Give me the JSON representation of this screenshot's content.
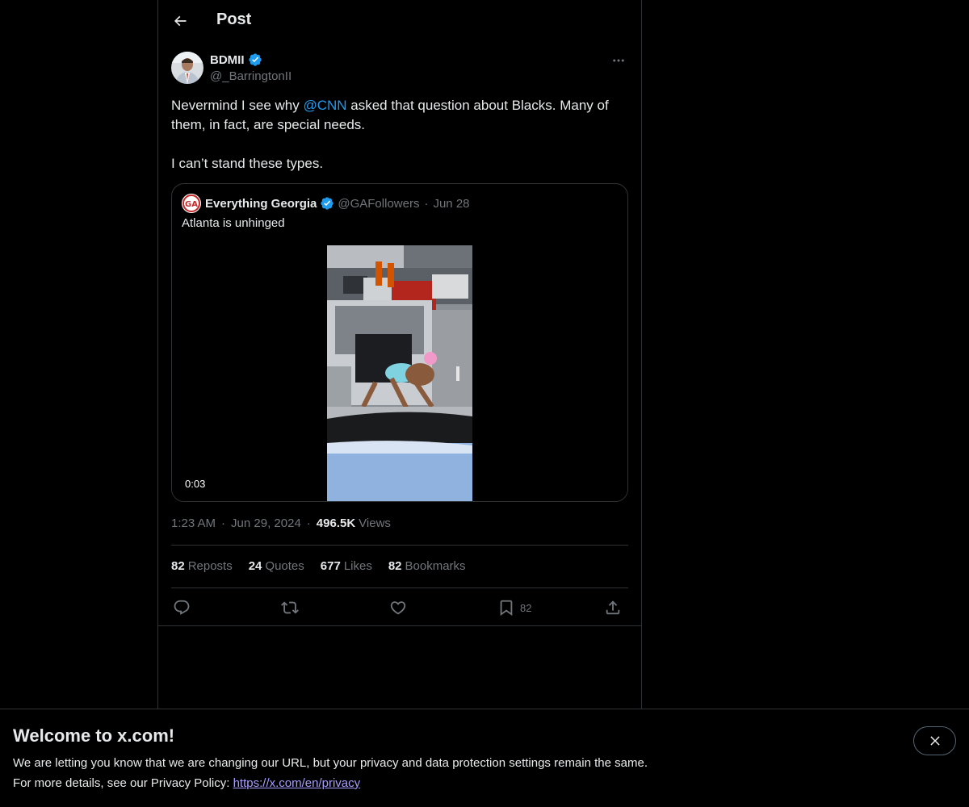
{
  "header": {
    "title": "Post"
  },
  "author": {
    "name": "BDMII",
    "handle": "@_BarringtonII",
    "verified": true
  },
  "tweet": {
    "text_before_mention": "Nevermind I see why ",
    "mention": "@CNN",
    "text_after_mention": " asked that question about Blacks. Many of them, in fact, are special needs.",
    "text_second_paragraph": "I can’t stand these types."
  },
  "quoted": {
    "name": "Everything Georgia",
    "handle": "@GAFollowers",
    "separator": "·",
    "date": "Jun 28",
    "text": "Atlanta is unhinged",
    "video_duration": "0:03",
    "avatar_text": "GA"
  },
  "meta": {
    "time": "1:23 AM",
    "separator": "·",
    "date": "Jun 29, 2024",
    "views_count": "496.5K",
    "views_label": "Views"
  },
  "stats": [
    {
      "count": "82",
      "label": "Reposts"
    },
    {
      "count": "24",
      "label": "Quotes"
    },
    {
      "count": "677",
      "label": "Likes"
    },
    {
      "count": "82",
      "label": "Bookmarks"
    }
  ],
  "actions": {
    "reply_icon": "reply-icon",
    "repost_icon": "repost-icon",
    "like_icon": "heart-icon",
    "bookmark_icon": "bookmark-icon",
    "bookmark_count": "82",
    "share_icon": "share-icon"
  },
  "banner": {
    "title": "Welcome to x.com!",
    "line1": "We are letting you know that we are changing our URL, but your privacy and data protection settings remain the same.",
    "line2_prefix": "For more details, see our Privacy Policy: ",
    "link": "https://x.com/en/privacy"
  },
  "colors": {
    "background": "#000000",
    "text": "#e7e9ea",
    "secondary": "#71767b",
    "accent": "#1d9bf0",
    "link": "#a69dff",
    "border": "#2f3336"
  }
}
